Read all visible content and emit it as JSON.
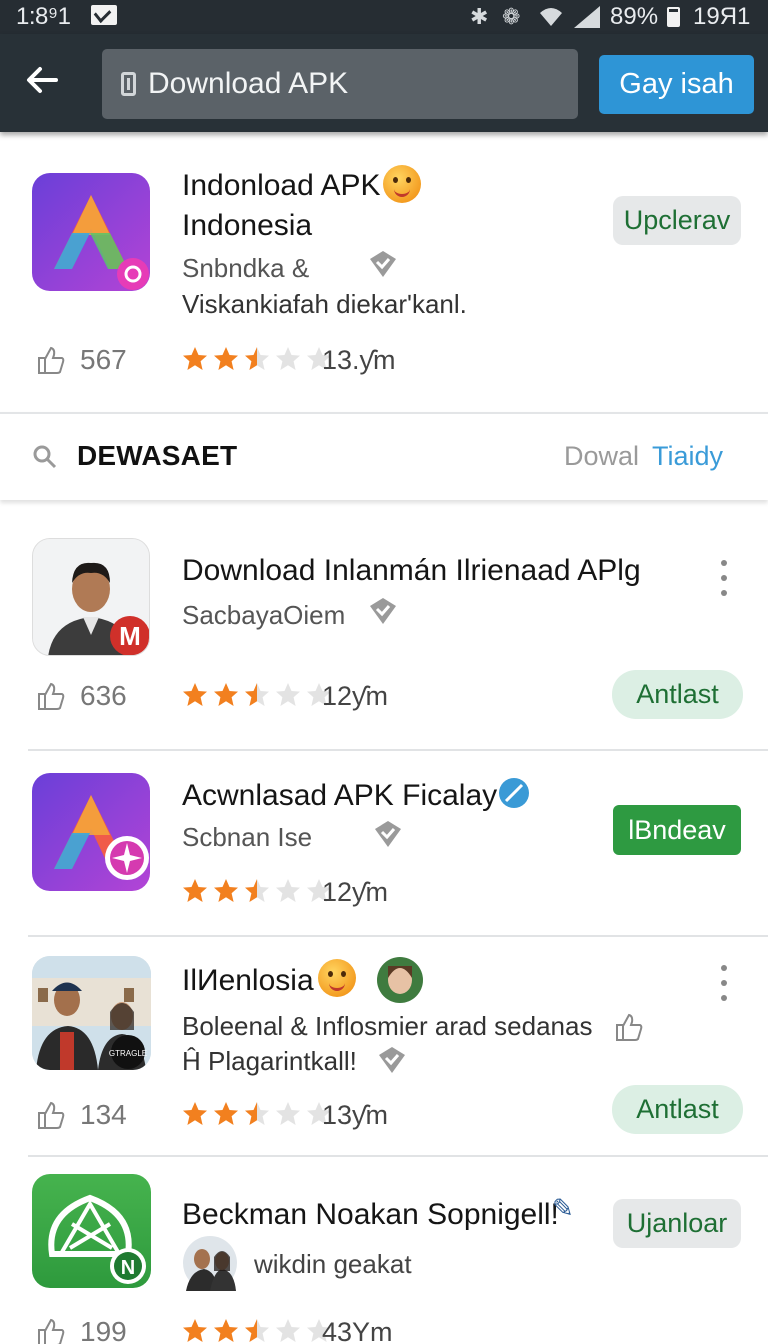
{
  "status_bar": {
    "time": "1:8⁹1",
    "battery": "89%",
    "clock_right": "19Я1"
  },
  "app_bar": {
    "search_value": "Download APK",
    "go_label": "Gay isah"
  },
  "search_row": {
    "query": "DEWASAET",
    "action_left": "Dowal",
    "action_right": "Tiaidy"
  },
  "apps": [
    {
      "title_line1": "Indonload APK",
      "title_line2": "Indonesia",
      "subtitle": "Snbndka &",
      "description": "Viskankiafah diekarʹkanl.",
      "likes": "567",
      "rating": 2.5,
      "meta": "13.ƴm",
      "button": "Upclerav"
    },
    {
      "title": "Download Inlanmán Ilrienaad APlg",
      "subtitle": "SacbayaOiem",
      "likes": "636",
      "rating": 2.5,
      "meta": "12ƴm",
      "button": "Antlast"
    },
    {
      "title": "Acwnlasad APK Ficalay",
      "subtitle": "Scbnan Ise",
      "rating": 2.5,
      "meta": "12ƴm",
      "button": "lBndeav"
    },
    {
      "title": "IlИenlosia",
      "description_line1": "Boleenal & Inflosmier arad sedanas",
      "description_line2": "Ĥ Plagarintkall!",
      "likes": "134",
      "rating": 2.5,
      "meta": "13ƴm",
      "button": "Antlast",
      "photo_caption": "GTRAGLE"
    },
    {
      "title": "Beckman Noakan Sopnigell!",
      "subtitle": "wikdin geakat",
      "likes": "199",
      "rating": 2.5,
      "meta": "43Ym",
      "button": "Ujanloar",
      "badge": "N"
    }
  ],
  "colors": {
    "app_bar": "#283137",
    "accent_blue": "#2e95d6",
    "star": "#f2801f",
    "green": "#2e9a41"
  }
}
